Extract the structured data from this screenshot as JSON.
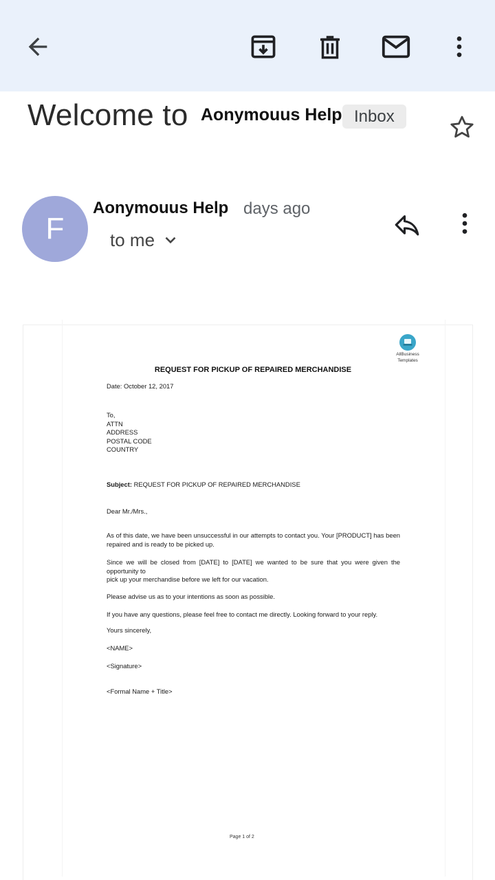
{
  "app_bar": {
    "back": "arrow-back-icon",
    "archive": "archive-icon",
    "delete": "trash-icon",
    "mark_unread": "mail-icon",
    "more": "more-vert-icon",
    "background": "#eaf1fb"
  },
  "subject": {
    "title": "Welcome to",
    "sender_overlay": "Aonymouus Help",
    "label_chip": "Inbox",
    "star": "star-outline-icon"
  },
  "message": {
    "avatar_letter": "F",
    "avatar_color": "#9fa8da",
    "sender_name": "Aonymouus Help",
    "time": "days ago",
    "recipients": "to me",
    "recipients_toggle": "chevron-down-icon",
    "reply": "reply-icon",
    "more": "more-vert-icon"
  },
  "letter": {
    "logo_line1": "AllBusiness",
    "logo_line2": "Templates",
    "title": "REQUEST FOR PICKUP OF REPAIRED MERCHANDISE",
    "date": "Date: October 12, 2017",
    "address": [
      "To,",
      "ATTN",
      "ADDRESS",
      "POSTAL CODE",
      "COUNTRY"
    ],
    "subject_label": "Subject:",
    "subject_text": "REQUEST FOR PICKUP OF REPAIRED MERCHANDISE",
    "greeting": "Dear Mr./Mrs.,",
    "para1": "As of this date, we have been unsuccessful in our attempts to contact you. Your [PRODUCT] has been repaired and is ready to be picked up.",
    "para2_line1": "Since we will be closed from [DATE] to [DATE] we wanted to be sure that you were given the opportunity to",
    "para2_line2": "pick up your merchandise before we left for our vacation.",
    "para3": "Please advise us as to your intentions as soon as possible.",
    "para4": "If you have any questions, please feel free to contact me directly. Looking forward to your reply.",
    "closing": "Yours sincerely,",
    "name": "<NAME>",
    "signature": "<Signature>",
    "formal_name": "<Formal Name + Title>",
    "page_number": "Page 1 of 2"
  }
}
